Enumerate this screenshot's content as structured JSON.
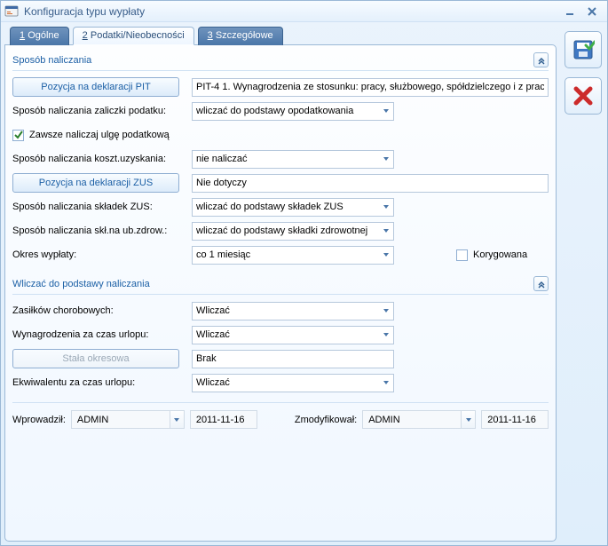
{
  "window": {
    "title": "Konfiguracja typu wypłaty"
  },
  "tabs": {
    "t1": {
      "num": "1",
      "label": "Ogólne"
    },
    "t2": {
      "num": "2",
      "label": "Podatki/Nieobecności"
    },
    "t3": {
      "num": "3",
      "label": "Szczegółowe"
    }
  },
  "group1": {
    "title": "Sposób naliczania",
    "pit_button": "Pozycja na deklaracji PIT",
    "pit_value": "PIT-4 1. Wynagrodzenia ze stosunku: pracy, służbowego, spółdzielczego i z prac",
    "zaliczka_label": "Sposób naliczania zaliczki podatku:",
    "zaliczka_value": "wliczać do podstawy opodatkowania",
    "ulga_label": "Zawsze naliczaj ulgę podatkową",
    "koszt_label": "Sposób naliczania koszt.uzyskania:",
    "koszt_value": "nie naliczać",
    "zus_button": "Pozycja na deklaracji ZUS",
    "zus_value": "Nie dotyczy",
    "skl_zus_label": "Sposób naliczania składek ZUS:",
    "skl_zus_value": "wliczać do podstawy składek ZUS",
    "skl_zdr_label": "Sposób naliczania skł.na ub.zdrow.:",
    "skl_zdr_value": "wliczać do podstawy składki zdrowotnej",
    "okres_label": "Okres wypłaty:",
    "okres_value": "co 1 miesiąc",
    "korygowana_label": "Korygowana"
  },
  "group2": {
    "title": "Wliczać do podstawy naliczania",
    "zas_label": "Zasiłków chorobowych:",
    "zas_value": "Wliczać",
    "wyn_label": "Wynagrodzenia za czas urlopu:",
    "wyn_value": "Wliczać",
    "stala_button": "Stała okresowa",
    "stala_value": "Brak",
    "ekw_label": "Ekwiwalentu za czas urlopu:",
    "ekw_value": "Wliczać"
  },
  "audit": {
    "wprowadzil_label": "Wprowadził:",
    "wprowadzil_user": "ADMIN",
    "wprowadzil_date": "2011-11-16",
    "zmodyfikowal_label": "Zmodyfikował:",
    "zmodyfikowal_user": "ADMIN",
    "zmodyfikowal_date": "2011-11-16"
  }
}
